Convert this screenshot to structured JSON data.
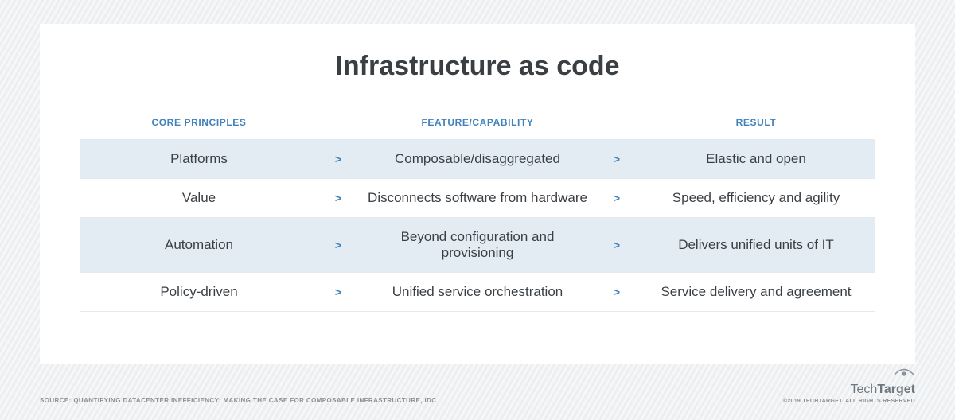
{
  "title": "Infrastructure as code",
  "headers": {
    "core": "CORE PRINCIPLES",
    "feature": "FEATURE/CAPABILITY",
    "result": "RESULT"
  },
  "rows": [
    {
      "core": "Platforms",
      "feature": "Composable/disaggregated",
      "result": "Elastic and open"
    },
    {
      "core": "Value",
      "feature": "Disconnects software from hardware",
      "result": "Speed, efficiency and agility"
    },
    {
      "core": "Automation",
      "feature": "Beyond configuration and provisioning",
      "result": "Delivers unified units of IT"
    },
    {
      "core": "Policy-driven",
      "feature": "Unified service orchestration",
      "result": "Service delivery and agreement"
    }
  ],
  "source": "SOURCE: QUANTIFYING DATACENTER INEFFICIENCY: MAKING THE CASE FOR COMPOSABLE INFRASTRUCTURE, IDC",
  "brand_prefix": "Tech",
  "brand_suffix": "Target",
  "copyright": "©2019 TECHTARGET. ALL RIGHTS RESERVED",
  "arrow": ">"
}
